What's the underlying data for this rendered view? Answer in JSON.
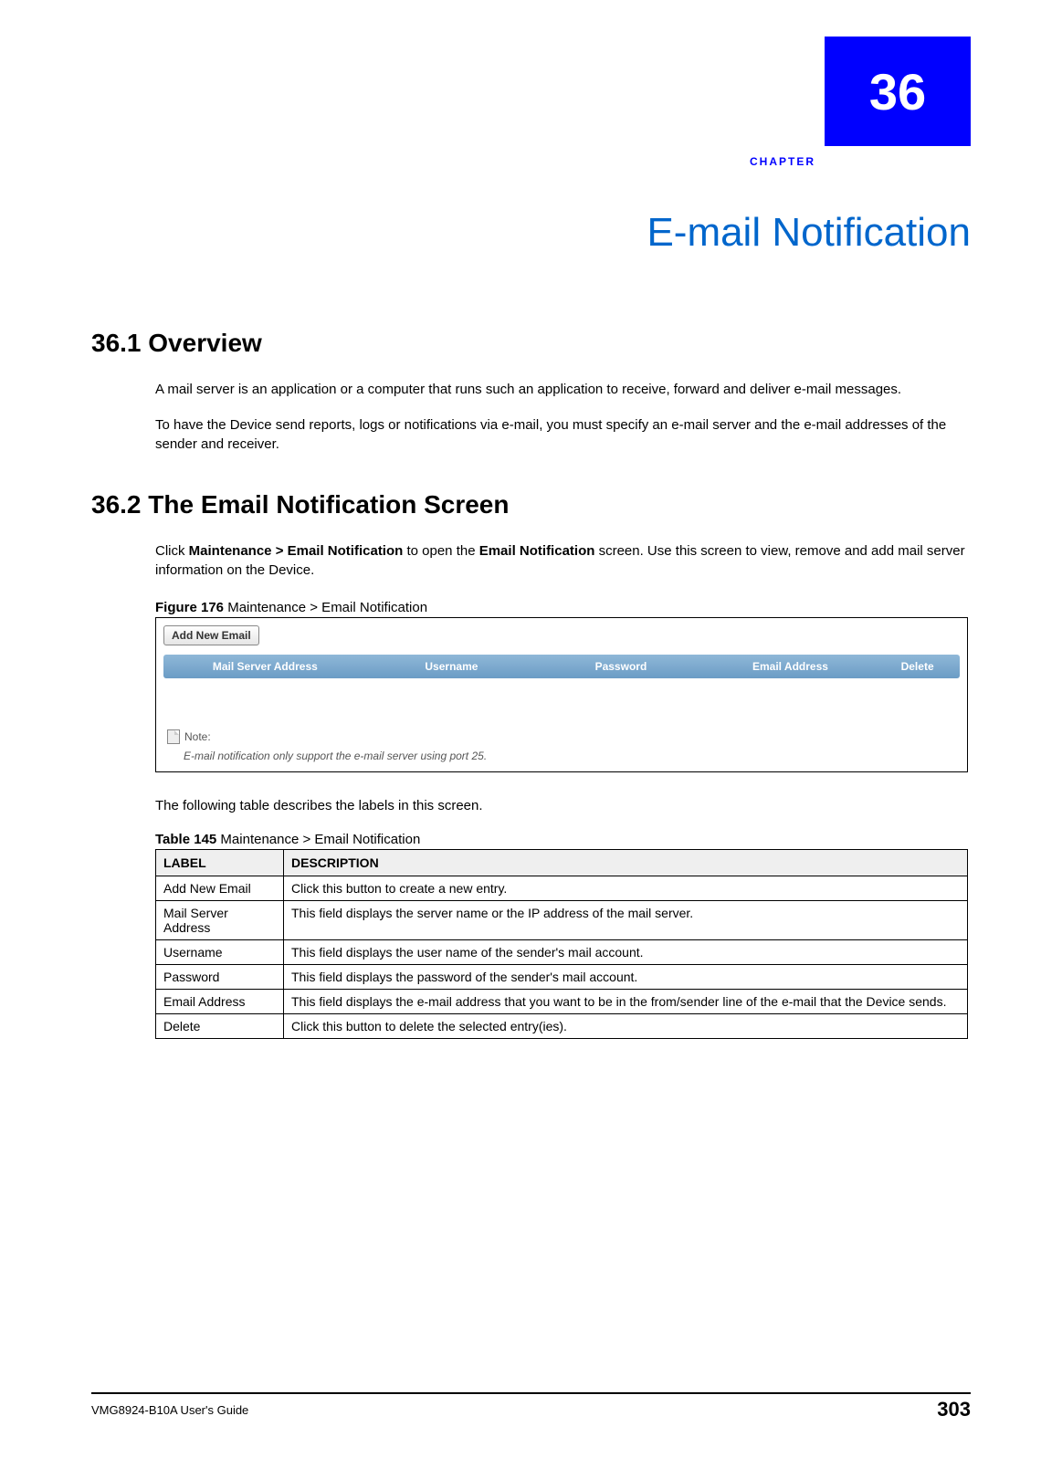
{
  "chapter": {
    "number": "36",
    "label": "CHAPTER",
    "title": "E-mail Notification"
  },
  "sections": {
    "overview": {
      "heading": "36.1  Overview",
      "p1": "A mail server is an application or a computer that runs such an application to receive, forward and deliver e-mail messages.",
      "p2": "To have the Device send reports, logs or notifications via e-mail, you must specify an e-mail server and the e-mail addresses of the sender and receiver."
    },
    "screen": {
      "heading": "36.2  The Email Notification Screen",
      "intro_pre": "Click ",
      "intro_bold1": "Maintenance > Email Notification",
      "intro_mid": " to open the ",
      "intro_bold2": "Email Notification",
      "intro_post": " screen. Use this screen to view, remove and add mail server information on the Device.",
      "figure_label": "Figure 176",
      "figure_caption": "   Maintenance > Email Notification"
    }
  },
  "screenshot": {
    "button": "Add New Email",
    "headers": {
      "col1": "Mail Server Address",
      "col2": "Username",
      "col3": "Password",
      "col4": "Email Address",
      "col5": "Delete"
    },
    "note_label": "Note:",
    "note_text": "E-mail notification only support the e-mail server using port 25."
  },
  "table": {
    "intro": "The following table describes the labels in this screen.",
    "caption_label": "Table 145",
    "caption_text": "   Maintenance > Email Notification",
    "header": {
      "label": "LABEL",
      "desc": "DESCRIPTION"
    },
    "rows": [
      {
        "label": "Add New Email",
        "desc": "Click this button to create a new entry."
      },
      {
        "label": "Mail Server Address",
        "desc": "This field displays the server name or the IP address of the mail server."
      },
      {
        "label": "Username",
        "desc": "This field displays the user name of the sender's mail account."
      },
      {
        "label": "Password",
        "desc": "This field displays the password of the sender's mail account."
      },
      {
        "label": "Email Address",
        "desc": "This field displays the e-mail address that you want to be in the from/sender line of the e-mail that the Device sends."
      },
      {
        "label": "Delete",
        "desc": "Click this button to delete the selected entry(ies)."
      }
    ]
  },
  "footer": {
    "guide": "VMG8924-B10A User's Guide",
    "page": "303"
  }
}
